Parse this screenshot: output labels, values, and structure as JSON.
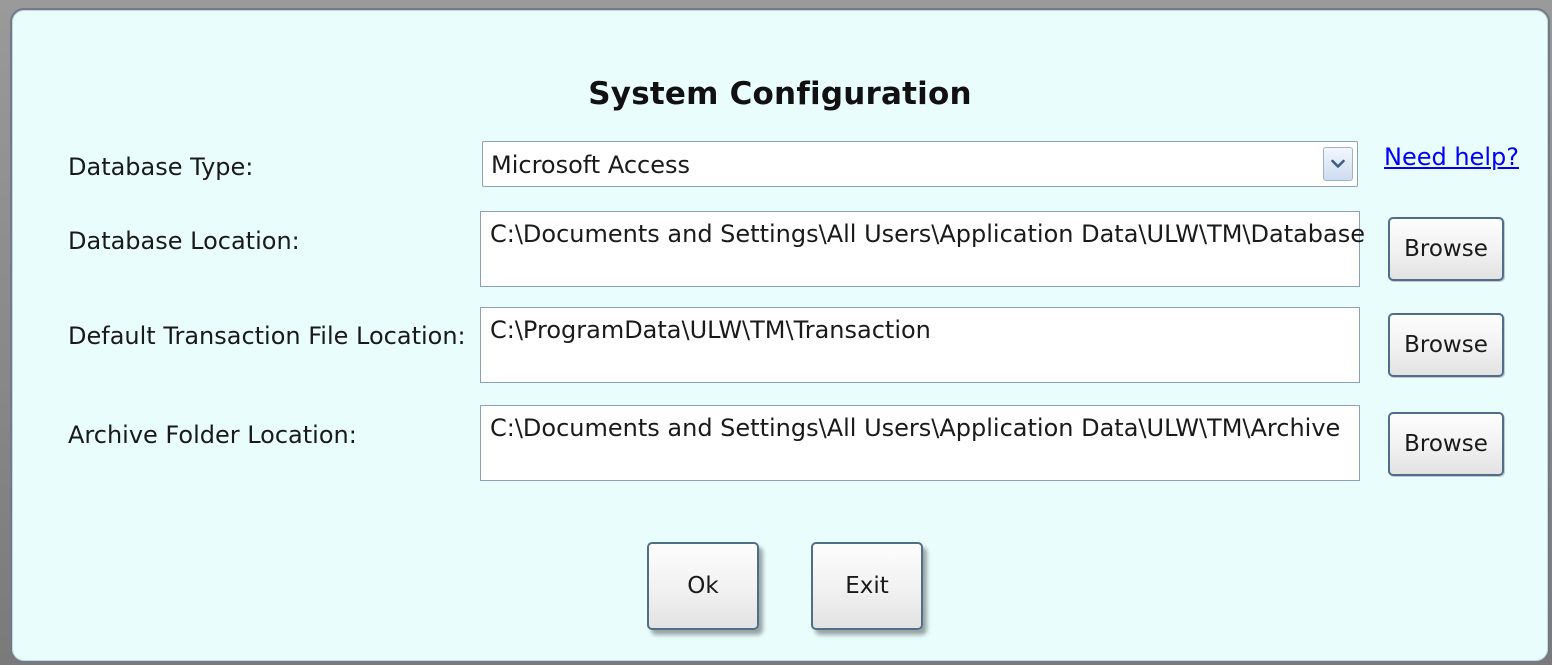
{
  "dialog": {
    "title": "System Configuration"
  },
  "database_type": {
    "label": "Database Type:",
    "selected": "Microsoft Access",
    "help_link": "Need help?"
  },
  "database_location": {
    "label": "Database Location:",
    "value": "C:\\Documents and Settings\\All Users\\Application Data\\ULW\\TM\\Database",
    "browse_label": "Browse"
  },
  "transaction_location": {
    "label": "Default Transaction File Location:",
    "value": "C:\\ProgramData\\ULW\\TM\\Transaction",
    "browse_label": "Browse"
  },
  "archive_location": {
    "label": "Archive Folder Location:",
    "value": "C:\\Documents and Settings\\All Users\\Application Data\\ULW\\TM\\Archive",
    "browse_label": "Browse"
  },
  "actions": {
    "ok_label": "Ok",
    "exit_label": "Exit"
  },
  "icons": {
    "dropdown": "chevron-down-icon"
  },
  "colors": {
    "background": "#eafdfd",
    "link": "#0000ff",
    "button_border": "#506e8a"
  }
}
